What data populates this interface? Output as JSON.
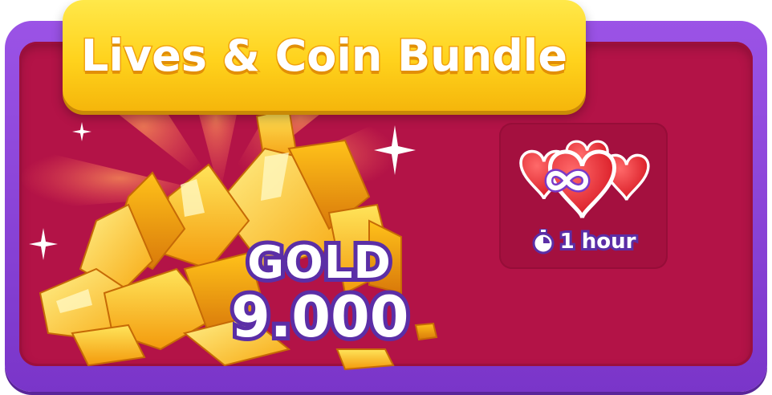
{
  "bundle": {
    "title": "Lives & Coin Bundle"
  },
  "gold": {
    "label": "GOLD",
    "amount": "9.000"
  },
  "lives": {
    "duration": "1 hour",
    "icon": "infinity-hearts-icon",
    "timer_icon": "stopwatch-icon"
  },
  "colors": {
    "frame": "#8a44d8",
    "panel": "#b31347",
    "banner": "#ffd21c",
    "text_outline": "#5b2ea6"
  }
}
